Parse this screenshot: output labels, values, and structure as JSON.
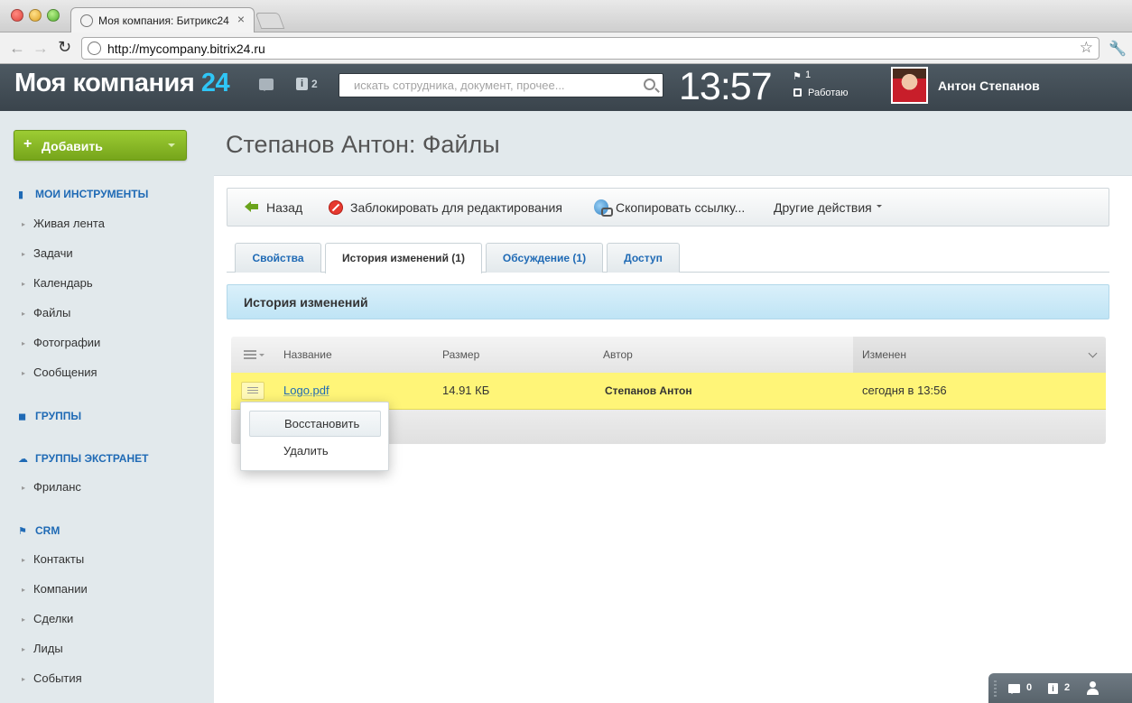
{
  "browser": {
    "tab_title": "Моя компания: Битрикс24",
    "url": "http://mycompany.bitrix24.ru"
  },
  "header": {
    "logo_text": "Моя компания",
    "logo_num": "24",
    "info_count": "2",
    "search_placeholder": "искать сотрудника, документ, прочее...",
    "clock": "13:57",
    "flag_count": "1",
    "work_status": "Работаю",
    "user_name": "Антон Степанов"
  },
  "sidebar": {
    "add_button": "Добавить",
    "sections": [
      {
        "title": "МОИ ИНСТРУМЕНТЫ",
        "items": [
          "Живая лента",
          "Задачи",
          "Календарь",
          "Файлы",
          "Фотографии",
          "Сообщения"
        ]
      },
      {
        "title": "ГРУППЫ",
        "items": []
      },
      {
        "title": "ГРУППЫ ЭКСТРАНЕТ",
        "items": [
          "Фриланс"
        ]
      },
      {
        "title": "CRM",
        "items": [
          "Контакты",
          "Компании",
          "Сделки",
          "Лиды",
          "События"
        ]
      }
    ]
  },
  "page": {
    "title": "Степанов Антон: Файлы"
  },
  "toolbar": {
    "back": "Назад",
    "lock": "Заблокировать для редактирования",
    "copy_link": "Скопировать ссылку...",
    "other": "Другие действия"
  },
  "tabs": [
    {
      "label": "Свойства",
      "active": false
    },
    {
      "label": "История изменений (1)",
      "active": true
    },
    {
      "label": "Обсуждение (1)",
      "active": false
    },
    {
      "label": "Доступ",
      "active": false
    }
  ],
  "section_header": "История изменений",
  "grid": {
    "columns": [
      "Название",
      "Размер",
      "Автор",
      "Изменен"
    ],
    "rows": [
      {
        "name": "Logo.pdf",
        "size": "14.91 КБ",
        "author": "Степанов Антон",
        "modified": "сегодня в 13:56"
      }
    ]
  },
  "context_menu": {
    "items": [
      "Восстановить",
      "Удалить"
    ]
  },
  "bottom_bar": {
    "chat_count": "0",
    "info_count": "2"
  },
  "colors": {
    "accent": "#1f6ab5",
    "logo_num": "#2fc6f6",
    "add_button": "#8cbf2a",
    "row_highlight": "#fff578",
    "header_bg": "#434e56"
  }
}
